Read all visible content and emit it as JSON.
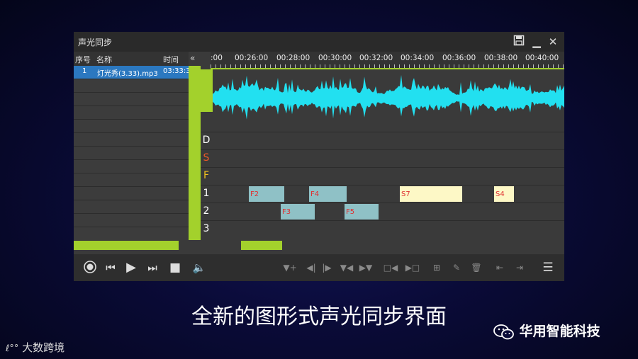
{
  "window": {
    "title": "声光同步"
  },
  "list": {
    "headers": {
      "index": "序号",
      "name": "名称",
      "time": "时间"
    },
    "rows": [
      {
        "index": "1",
        "name": "灯光秀(3.33).mp3",
        "time": "03:33:3"
      }
    ]
  },
  "timeline": {
    "labels": [
      ":00",
      "00:26:00",
      "00:28:00",
      "00:30:00",
      "00:32:00",
      "00:34:00",
      "00:36:00",
      "00:38:00",
      "00:40:00"
    ]
  },
  "tracks": {
    "lanes": [
      {
        "label": "D",
        "color": "#ffffff"
      },
      {
        "label": "S",
        "color": "#f05a28"
      },
      {
        "label": "F",
        "color": "#f0c020"
      },
      {
        "label": "1",
        "color": "#ffffff"
      },
      {
        "label": "2",
        "color": "#ffffff"
      },
      {
        "label": "3",
        "color": "#ffffff"
      }
    ],
    "blocks": [
      "F2",
      "F4",
      "S7",
      "S4",
      "F3",
      "F5"
    ]
  },
  "subtitle": "全新的图形式声光同步界面",
  "brand": "大数跨境",
  "wechat_account": "华用智能科技",
  "colors": {
    "accent": "#a3d12c",
    "waveform": "#22e0f0",
    "selection": "#2b78c0"
  }
}
